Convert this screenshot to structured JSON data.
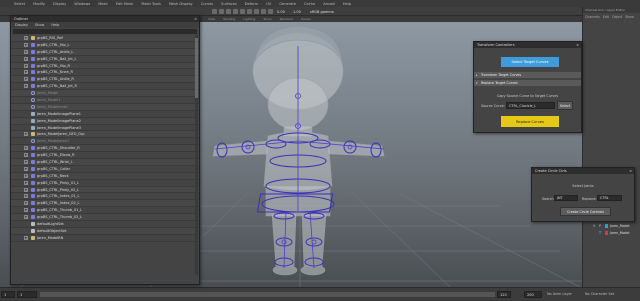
{
  "top_menu": [
    "Select",
    "Modify",
    "Display",
    "Windows",
    "Mesh",
    "Edit Mesh",
    "Mesh Tools",
    "Mesh Display",
    "Curves",
    "Surfaces",
    "Deform",
    "UV",
    "Generate",
    "Cache",
    "Arnold",
    "Help"
  ],
  "toolbar": {
    "value_a": "0.00",
    "value_b": "1.00",
    "color_mode": "sRGB gamma"
  },
  "viewport_menu": [
    "View",
    "Shading",
    "Lighting",
    "Show",
    "Renderer",
    "Panels"
  ],
  "outliner": {
    "title": "Outliner",
    "menu": [
      "Display",
      "Show",
      "Help"
    ],
    "items": [
      {
        "name": "grpBS_RIG_Ref",
        "icon": "group-icon",
        "expandable": true,
        "dim": false
      },
      {
        "name": "grpBS_CTRL_Hip_L",
        "icon": "control-icon",
        "expandable": true,
        "dim": false
      },
      {
        "name": "grpBS_CTRL_Ankle_L",
        "icon": "control-icon",
        "expandable": true,
        "dim": false
      },
      {
        "name": "grpBS_CTRL_Ball_Jnt_L",
        "icon": "control-icon",
        "expandable": true,
        "dim": false
      },
      {
        "name": "grpBS_CTRL_Hip_R",
        "icon": "control-icon",
        "expandable": true,
        "dim": false
      },
      {
        "name": "grpBS_CTRL_Knee_R",
        "icon": "control-icon",
        "expandable": true,
        "dim": false
      },
      {
        "name": "grpBS_CTRL_Ankle_R",
        "icon": "control-icon",
        "expandable": true,
        "dim": false
      },
      {
        "name": "grpBS_CTRL_Ball_Jnt_R",
        "icon": "control-icon",
        "expandable": true,
        "dim": false
      },
      {
        "name": "Jaren_Model",
        "icon": "ring-icon",
        "expandable": false,
        "dim": true
      },
      {
        "name": "Jaren_Model1",
        "icon": "ring-icon",
        "expandable": false,
        "dim": true
      },
      {
        "name": "Jaren_Modelmesh",
        "icon": "ring-icon",
        "expandable": false,
        "dim": true
      },
      {
        "name": "Jaren_ModelImagePlane1",
        "icon": "image-plane-icon",
        "expandable": false,
        "dim": false
      },
      {
        "name": "Jaren_ModelImagePlane2",
        "icon": "image-plane-icon",
        "expandable": false,
        "dim": false
      },
      {
        "name": "Jaren_ModelImagePlane3",
        "icon": "image-plane-icon",
        "expandable": false,
        "dim": false
      },
      {
        "name": "Jaren_ModelJaren_GEO_Grp",
        "icon": "group-icon",
        "expandable": true,
        "dim": false
      },
      {
        "name": "Jaren_ModelJaren1",
        "icon": "ring-icon",
        "expandable": false,
        "dim": true
      },
      {
        "name": "grpBS_CTRL_Shoulder_R",
        "icon": "control-icon",
        "expandable": true,
        "dim": false
      },
      {
        "name": "grpBS_CTRL_Elbow_R",
        "icon": "control-icon",
        "expandable": true,
        "dim": false
      },
      {
        "name": "grpBS_CTRL_Wrist_L",
        "icon": "control-icon",
        "expandable": true,
        "dim": false
      },
      {
        "name": "grpBS_CTRL_Collar",
        "icon": "control-icon",
        "expandable": true,
        "dim": false
      },
      {
        "name": "grpBS_CTRL_Neck",
        "icon": "control-icon",
        "expandable": true,
        "dim": false
      },
      {
        "name": "grpBS_CTRL_Pinky_01_L",
        "icon": "control-icon",
        "expandable": true,
        "dim": false
      },
      {
        "name": "grpBS_CTRL_Pinky_02_L",
        "icon": "control-icon",
        "expandable": true,
        "dim": false
      },
      {
        "name": "grpBS_CTRL_Index_01_L",
        "icon": "control-icon",
        "expandable": true,
        "dim": false
      },
      {
        "name": "grpBS_CTRL_Index_02_L",
        "icon": "control-icon",
        "expandable": true,
        "dim": false
      },
      {
        "name": "grpBS_CTRL_Thumb_01_L",
        "icon": "control-icon",
        "expandable": true,
        "dim": false
      },
      {
        "name": "grpBS_CTRL_Thumb_02_L",
        "icon": "control-icon",
        "expandable": true,
        "dim": false
      },
      {
        "name": "defaultLightSet",
        "icon": "light-set-icon",
        "expandable": false,
        "dim": false
      },
      {
        "name": "defaultObjectSet",
        "icon": "object-set-icon",
        "expandable": false,
        "dim": false
      },
      {
        "name": "Jaren_ModelRN",
        "icon": "reference-icon",
        "expandable": true,
        "dim": false
      }
    ]
  },
  "transform_panel": {
    "title": "Transform Controllers",
    "close": "×",
    "select_target_label": "Select Target Curves",
    "section_transform": "Transform Target Curves",
    "section_replace": "Replace Target Curves",
    "copy_text": "Copy Source Curve to Target Curves",
    "source_label": "Source Curve:",
    "source_value": "CTRL_Clavicle_L",
    "select_label": "Select",
    "replace_label": "Replace Curves"
  },
  "circle_panel": {
    "title": "Create Circle Ctrls",
    "close": "×",
    "heading": "Select Joints",
    "search_label": "Search:",
    "search_value": "JNT",
    "replace_label": "Replace:",
    "replace_value": "CTRL",
    "create_label": "Create Circle Controls"
  },
  "channel_box": {
    "title": "Channel box / Layer Editor",
    "menu": [
      "Channels",
      "Edit",
      "Object",
      "Show"
    ],
    "layers": [
      {
        "vis": "V",
        "flag": "P",
        "color": "#3aa0c8",
        "name": "Jaren_Model:"
      },
      {
        "vis": "",
        "flag": "T",
        "color": "#c83a5a",
        "name": "Jaren_Model:"
      }
    ]
  },
  "timeline": {
    "start": "1",
    "current": "1",
    "end": "120",
    "range_end": "200",
    "end_field": "200",
    "anim_layer": "No Anim Layer",
    "char_set": "No Character Set",
    "fps": "24 fps"
  },
  "colors": {
    "accent_blue": "#3e9cdd",
    "accent_yellow": "#e6c817",
    "control_curves": "#3a2fb8"
  }
}
